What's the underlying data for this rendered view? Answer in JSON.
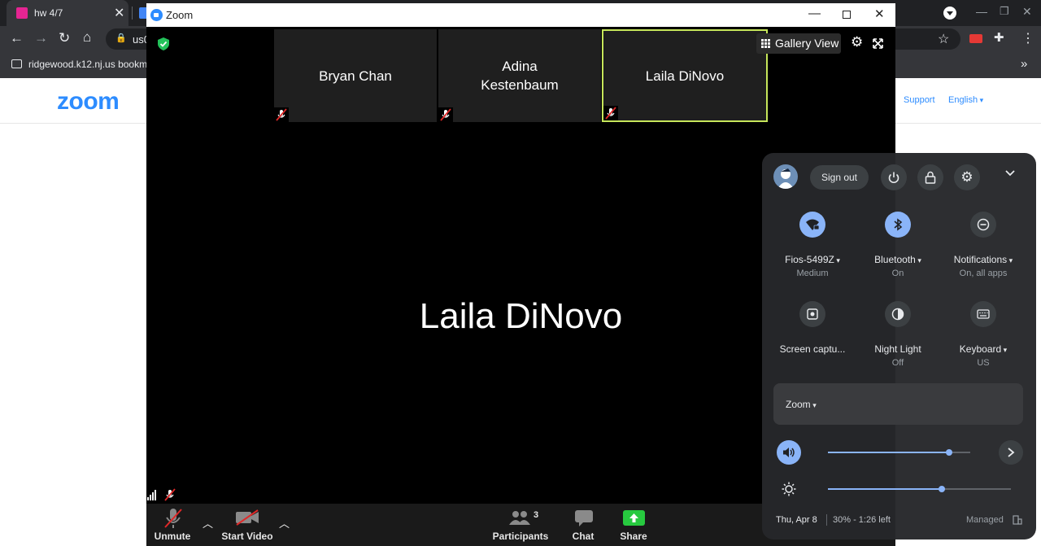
{
  "browser": {
    "tab1_title": "hw 4/7",
    "address_fragment": "us0",
    "bookmark": "ridgewood.k12.nj.us bookma",
    "chevron": "»"
  },
  "site": {
    "logo": "zoom",
    "support_link": "Support",
    "language": "English"
  },
  "zoom": {
    "window_title": "Zoom",
    "gallery_view": "Gallery View",
    "tiles": [
      {
        "name": "Bryan Chan"
      },
      {
        "name": "Adina\nKestenbaum"
      },
      {
        "name": "Laila DiNovo"
      }
    ],
    "active_speaker": "Laila DiNovo",
    "controls": {
      "unmute": "Unmute",
      "start_video": "Start Video",
      "participants": "Participants",
      "participants_count": "3",
      "chat": "Chat",
      "share": "Share"
    }
  },
  "quick_settings": {
    "sign_out": "Sign out",
    "features": [
      {
        "label": "Fios-5499Z",
        "sub": "Medium",
        "icon": "wifi-icon",
        "on": true,
        "dropdown": true
      },
      {
        "label": "Bluetooth",
        "sub": "On",
        "icon": "bluetooth-icon",
        "on": true,
        "dropdown": true
      },
      {
        "label": "Notifications",
        "sub": "On, all apps",
        "icon": "do-not-disturb-icon",
        "on": false,
        "dropdown": true
      },
      {
        "label": "Screen captu...",
        "sub": "",
        "icon": "screen-capture-icon",
        "on": false,
        "dropdown": false
      },
      {
        "label": "Night Light",
        "sub": "Off",
        "icon": "night-light-icon",
        "on": false,
        "dropdown": false
      },
      {
        "label": "Keyboard",
        "sub": "US",
        "icon": "keyboard-icon",
        "on": false,
        "dropdown": true
      }
    ],
    "media_title": "Zoom",
    "volume_level": 0.85,
    "brightness_level": 0.62,
    "date": "Thu, Apr 8",
    "battery": "30% - 1:26 left",
    "managed": "Managed"
  },
  "colors": {
    "accent_blue": "#8ab4f8",
    "zoom_blue": "#2d8cff",
    "active_tile_border": "#c6e65a",
    "share_green": "#27c93f"
  }
}
